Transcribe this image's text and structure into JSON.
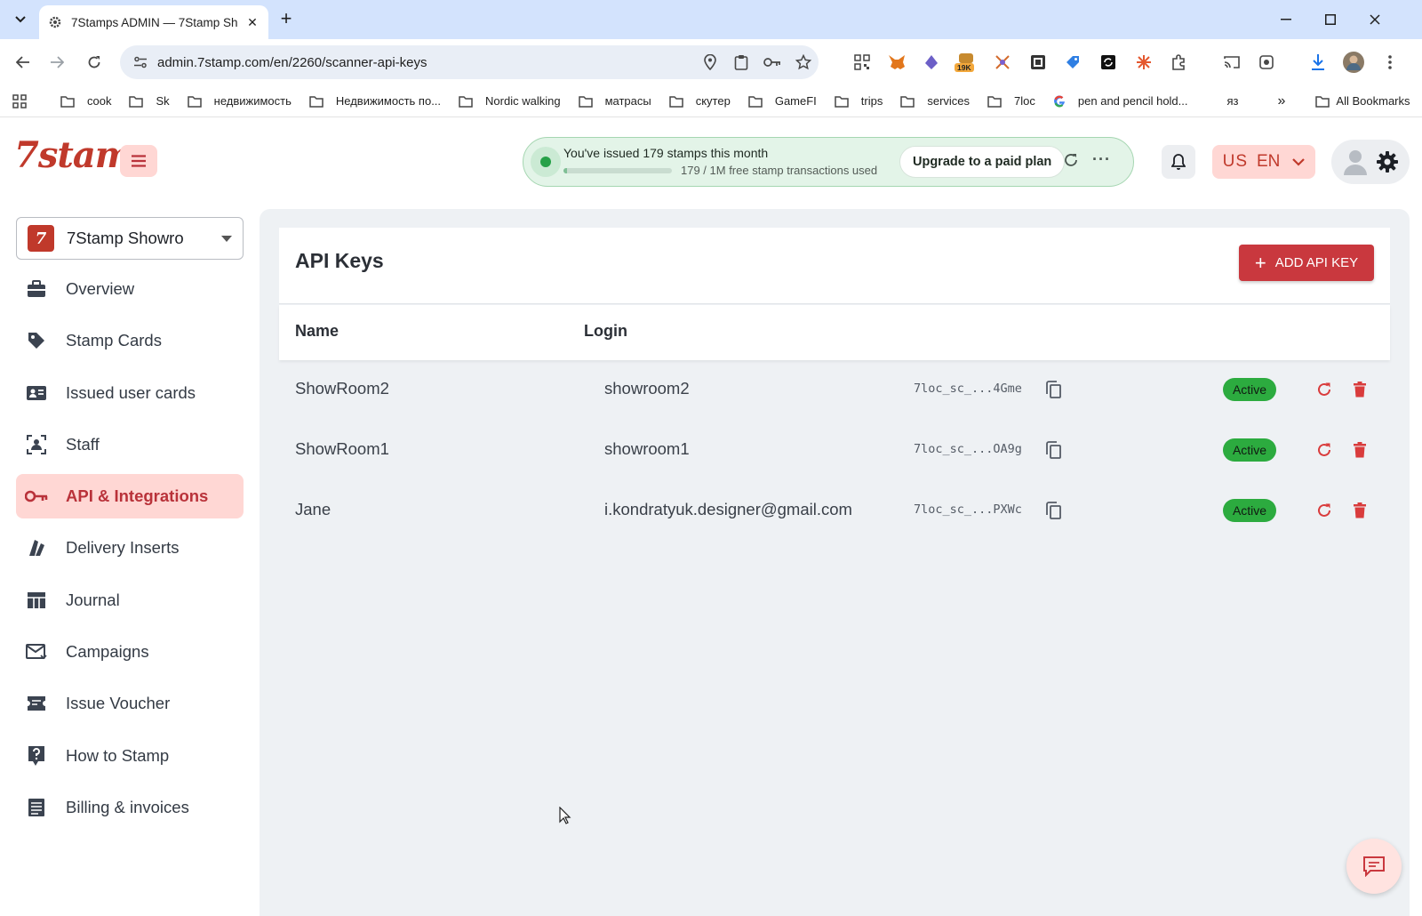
{
  "browser": {
    "tab_title": "7Stamps ADMIN — 7Stamp Sh",
    "url": "admin.7stamp.com/en/2260/scanner-api-keys",
    "extension_badge": "19K",
    "bookmarks": [
      {
        "label": "cook",
        "icon": "folder-icon"
      },
      {
        "label": "Sk",
        "icon": "folder-icon"
      },
      {
        "label": "недвижимость",
        "icon": "folder-icon"
      },
      {
        "label": "Недвижимость по...",
        "icon": "folder-icon"
      },
      {
        "label": "Nordic walking",
        "icon": "folder-icon"
      },
      {
        "label": "матрасы",
        "icon": "folder-icon"
      },
      {
        "label": "скутер",
        "icon": "folder-icon"
      },
      {
        "label": "GameFI",
        "icon": "folder-icon"
      },
      {
        "label": "trips",
        "icon": "folder-icon"
      },
      {
        "label": "services",
        "icon": "folder-icon"
      },
      {
        "label": "7loc",
        "icon": "folder-icon"
      },
      {
        "label": "pen and pencil hold...",
        "icon": "google-icon"
      },
      {
        "label": "яз",
        "icon": "none"
      }
    ],
    "all_bookmarks_label": "All Bookmarks"
  },
  "header": {
    "logo_text": "7stamp",
    "usage": {
      "headline": "You've issued 179 stamps this month",
      "subtext": "179 / 1M free stamp transactions used",
      "progress": 0.03,
      "upgrade_label": "Upgrade to a paid plan"
    },
    "language": {
      "flag": "US",
      "code": "EN"
    }
  },
  "sidebar": {
    "store_name": "7Stamp Showro",
    "items": [
      {
        "label": "Overview",
        "icon": "briefcase-icon",
        "active": false
      },
      {
        "label": "Stamp Cards",
        "icon": "tag-icon",
        "active": false
      },
      {
        "label": "Issued user cards",
        "icon": "id-card-icon",
        "active": false
      },
      {
        "label": "Staff",
        "icon": "staff-icon",
        "active": false
      },
      {
        "label": "API & Integrations",
        "icon": "key-icon",
        "active": true
      },
      {
        "label": "Delivery Inserts",
        "icon": "inserts-icon",
        "active": false
      },
      {
        "label": "Journal",
        "icon": "table-icon",
        "active": false
      },
      {
        "label": "Campaigns",
        "icon": "mail-icon",
        "active": false
      },
      {
        "label": "Issue Voucher",
        "icon": "ticket-icon",
        "active": false
      },
      {
        "label": "How to Stamp",
        "icon": "help-icon",
        "active": false
      },
      {
        "label": "Billing & invoices",
        "icon": "invoice-icon",
        "active": false
      }
    ]
  },
  "main": {
    "title": "API Keys",
    "add_button_label": "ADD API KEY",
    "columns": [
      "Name",
      "Login"
    ],
    "rows": [
      {
        "name": "ShowRoom2",
        "login": "showroom2",
        "key": "7loc_sc_...4Gme",
        "status": "Active"
      },
      {
        "name": "ShowRoom1",
        "login": "showroom1",
        "key": "7loc_sc_...OA9g",
        "status": "Active"
      },
      {
        "name": "Jane",
        "login": "i.kondratyuk.designer@gmail.com",
        "key": "7loc_sc_...PXWc",
        "status": "Active"
      }
    ]
  },
  "colors": {
    "brand_red": "#c9383e",
    "active_green": "#2cab3f",
    "sidebar_active_bg": "#ffd7d4",
    "usage_bg": "#e3f4e8"
  }
}
